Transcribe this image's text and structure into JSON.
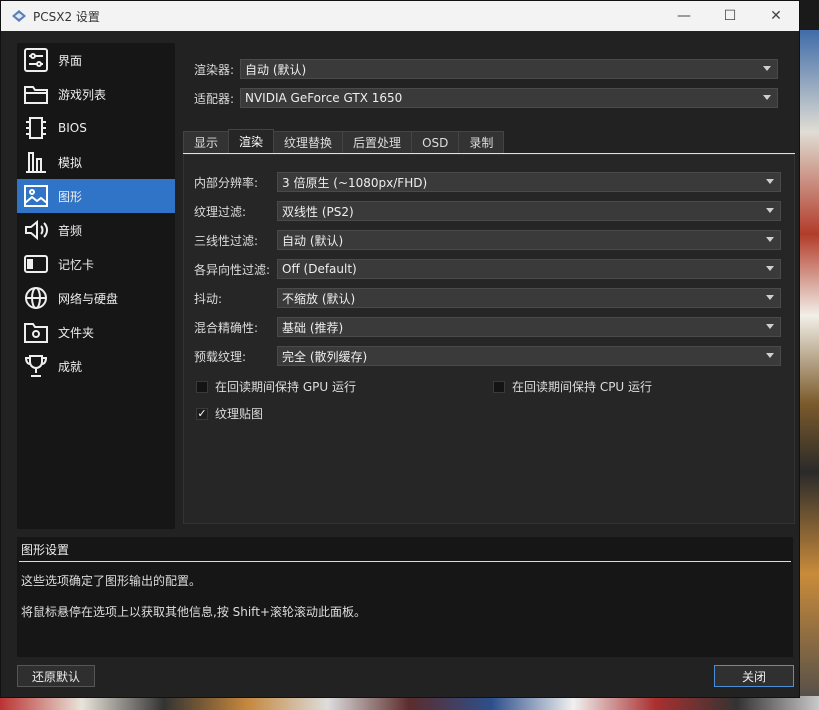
{
  "window": {
    "title": "PCSX2 设置",
    "minimize": "—",
    "maximize": "☐",
    "close": "✕"
  },
  "sidebar": {
    "items": [
      {
        "label": "界面",
        "icon": "interface-icon"
      },
      {
        "label": "游戏列表",
        "icon": "folder-icon"
      },
      {
        "label": "BIOS",
        "icon": "chip-icon"
      },
      {
        "label": "模拟",
        "icon": "emulation-icon"
      },
      {
        "label": "图形",
        "icon": "image-icon",
        "active": true
      },
      {
        "label": "音频",
        "icon": "speaker-icon"
      },
      {
        "label": "记忆卡",
        "icon": "memory-card-icon"
      },
      {
        "label": "网络与硬盘",
        "icon": "globe-icon"
      },
      {
        "label": "文件夹",
        "icon": "folder-settings-icon"
      },
      {
        "label": "成就",
        "icon": "trophy-icon"
      }
    ]
  },
  "top": {
    "renderer_label": "渲染器:",
    "renderer_value": "自动 (默认)",
    "adapter_label": "适配器:",
    "adapter_value": "NVIDIA GeForce GTX 1650"
  },
  "tabs": [
    "显示",
    "渲染",
    "纹理替换",
    "后置处理",
    "OSD",
    "录制"
  ],
  "active_tab": "渲染",
  "form": [
    {
      "label": "内部分辨率:",
      "value": "3 倍原生 (~1080px/FHD)"
    },
    {
      "label": "纹理过滤:",
      "value": "双线性 (PS2)"
    },
    {
      "label": "三线性过滤:",
      "value": "自动 (默认)"
    },
    {
      "label": "各异向性过滤:",
      "value": "Off (Default)"
    },
    {
      "label": "抖动:",
      "value": "不缩放 (默认)"
    },
    {
      "label": "混合精确性:",
      "value": "基础 (推荐)"
    },
    {
      "label": "预载纹理:",
      "value": "完全 (散列缓存)"
    }
  ],
  "checkboxes": {
    "gpu_readback": {
      "label": "在回读期间保持 GPU 运行",
      "checked": false
    },
    "cpu_readback": {
      "label": "在回读期间保持 CPU 运行",
      "checked": false
    },
    "mipmapping": {
      "label": "纹理贴图",
      "checked": true,
      "mark": "✓"
    }
  },
  "description": {
    "title": "图形设置",
    "line1": "这些选项确定了图形输出的配置。",
    "line2": "将鼠标悬停在选项上以获取其他信息,按 Shift+滚轮滚动此面板。"
  },
  "buttons": {
    "restore_defaults": "还原默认",
    "close": "关闭"
  },
  "colors": {
    "accent": "#2f74c6",
    "window_bg": "#222222",
    "sidebar_bg": "#161616"
  }
}
